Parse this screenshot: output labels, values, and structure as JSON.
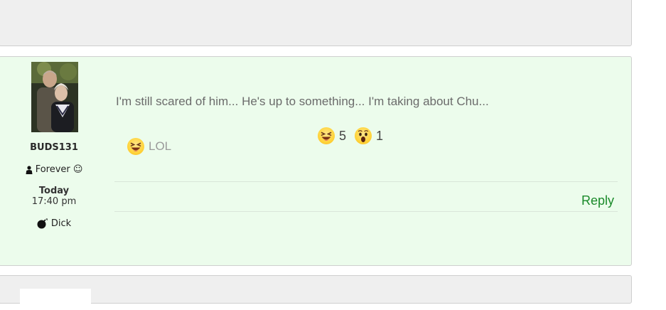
{
  "post": {
    "author": {
      "username": "BUDS131",
      "rank": "Forever ☺",
      "date_day": "Today",
      "date_time": "17:40 pm",
      "title": "Dick",
      "icons": {
        "rank_icon": "user-icon",
        "title_icon": "bomb-icon"
      }
    },
    "message": "I'm still scared of him... He's up to something... I'm taking about Chu...",
    "reaction_button": {
      "label": "LOL",
      "icon": "laughing-emoji-icon"
    },
    "reaction_counts": [
      {
        "icon": "laughing-emoji-icon",
        "count": "5"
      },
      {
        "icon": "wow-emoji-icon",
        "count": "1"
      }
    ],
    "reply_label": "Reply"
  },
  "colors": {
    "post_background": "#ecfcec",
    "neighbor_post_background": "#efefef",
    "reply_link": "#1a8a2a",
    "emoji_yellow": "#ffd43b"
  }
}
